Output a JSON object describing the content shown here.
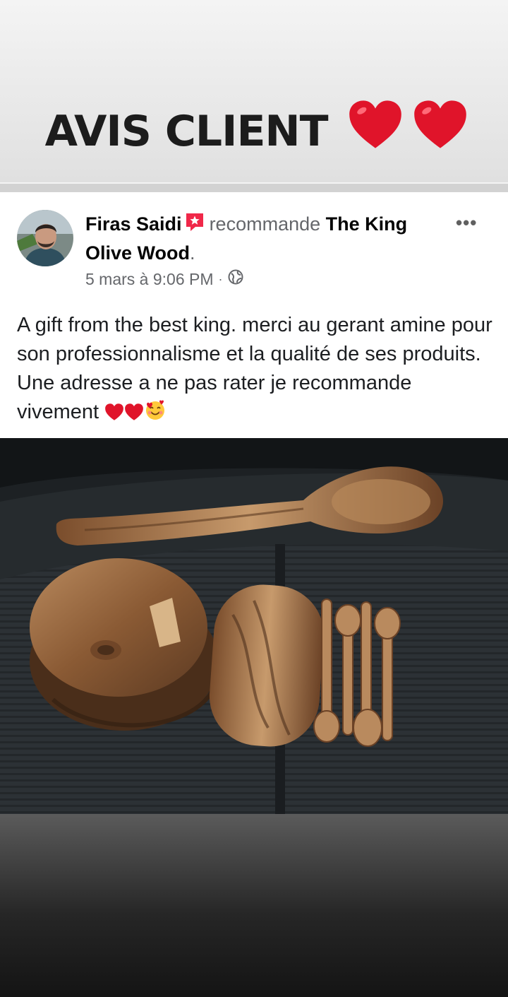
{
  "story": {
    "title": "AVIS CLIENT",
    "title_icons": [
      "red-heart-icon",
      "red-heart-icon"
    ]
  },
  "post": {
    "author": "Firas Saidi",
    "verb": "recommande",
    "page": "The King Olive Wood",
    "page_suffix": ".",
    "timestamp": "5 mars à 9:06 PM",
    "separator": "·",
    "privacy_icon": "globe-icon",
    "more_label": "•••",
    "text": "A gift from the best king. merci au gerant amine pour son professionnalisme et la qualité de ses produits. Une adresse a ne pas rater je recommande vivement",
    "text_emojis": [
      "red-heart-icon",
      "red-heart-icon",
      "smiling-face-with-hearts-icon"
    ]
  },
  "colors": {
    "heart": "#e0142a",
    "recommend_badge": "#f02849",
    "text_secondary": "#65676b"
  }
}
